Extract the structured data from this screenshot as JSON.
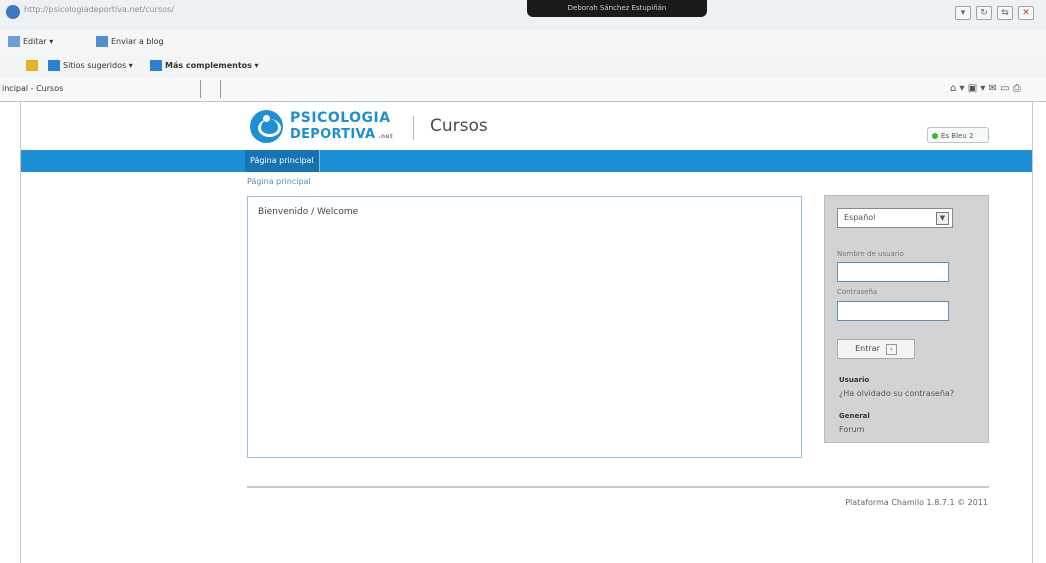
{
  "browser": {
    "url": "http://psicologiadeportiva.net/cursos/",
    "tooltip": "Deborah Sánchez Estupiñán",
    "toolbar1": {
      "edit": "Editar",
      "blog": "Enviar a blog"
    },
    "toolbar2": {
      "suggested": "Sitios sugeridos",
      "addons": "Más complementos"
    },
    "tab_title": "incipal - Cursos"
  },
  "site": {
    "brand_line1": "PSICOLOGIA",
    "brand_line2": "DEPORTIVA",
    "brand_suffix": ".net",
    "section": "Cursos",
    "lang_status": "Es Bleu 2",
    "nav_tab": "Página principal",
    "breadcrumb": "Página principal",
    "welcome": "Bienvenido / Welcome"
  },
  "login": {
    "language": "Español",
    "username_label": "Nombre de usuario",
    "password_label": "Contraseña",
    "submit": "Entrar",
    "user_heading": "Usuario",
    "forgot": "¿Ha olvidado su contraseña?",
    "general_heading": "General",
    "forum": "Forum"
  },
  "footer": {
    "text": "Plataforma Chamilo 1.8.7.1 © 2011"
  },
  "colors": {
    "accent": "#1d8fd7"
  }
}
